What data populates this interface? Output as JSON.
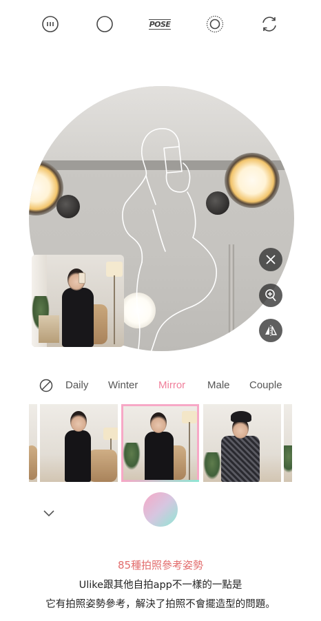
{
  "toolbar": {
    "items": [
      {
        "icon": "menu-dots-icon"
      },
      {
        "icon": "circle-ratio-icon"
      },
      {
        "icon": "pose-icon",
        "label": "POSE"
      },
      {
        "icon": "filter-ring-icon"
      },
      {
        "icon": "switch-camera-icon"
      }
    ]
  },
  "side_controls": [
    {
      "icon": "close-icon"
    },
    {
      "icon": "zoom-in-icon"
    },
    {
      "icon": "flip-horizontal-icon"
    }
  ],
  "categories": {
    "none_icon": "no-filter-icon",
    "items": [
      "Daily",
      "Winter",
      "Mirror",
      "Male",
      "Couple"
    ],
    "active": "Mirror",
    "active_color": "#f07e9a"
  },
  "pose_strip": {
    "selected_index": 1,
    "selected_outline_gradient": [
      "#f7a8c6",
      "#8fe6d4"
    ]
  },
  "shutter": {
    "gradient": [
      "#f7a8c6",
      "#8fe6d4"
    ]
  },
  "caption": {
    "title": "85種拍照參考姿勢",
    "title_color": "#e26c6c",
    "line1": "Ulike跟其他自拍app不一樣的一點是",
    "line2": "它有拍照姿勢參考，解決了拍照不會擺造型的問題。"
  }
}
